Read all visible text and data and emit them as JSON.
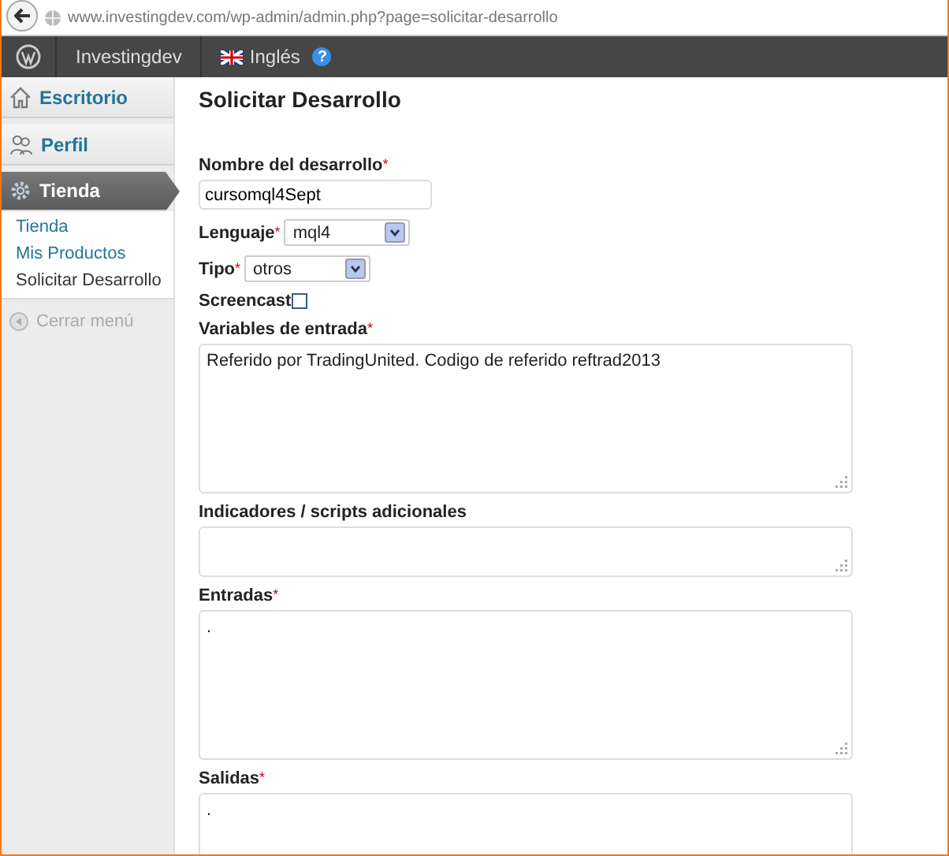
{
  "browser": {
    "url": "www.investingdev.com/wp-admin/admin.php?page=solicitar-desarrollo"
  },
  "admin_bar": {
    "site": "Investingdev",
    "language": "Inglés",
    "help": "?"
  },
  "sidebar": {
    "menus": [
      {
        "label": "Escritorio",
        "selected": false
      },
      {
        "label": "Perfil",
        "selected": false
      },
      {
        "label": "Tienda",
        "selected": true
      }
    ],
    "submenu": [
      {
        "label": "Tienda",
        "selected": false
      },
      {
        "label": "Mis Productos",
        "selected": false
      },
      {
        "label": "Solicitar Desarrollo",
        "selected": true
      }
    ],
    "collapse": "Cerrar menú"
  },
  "page": {
    "title": "Solicitar Desarrollo",
    "fields": [
      {
        "kind": "text",
        "label": "Nombre del desarrollo",
        "required_mark": "*",
        "value": "cursomql4Sept"
      },
      {
        "kind": "select",
        "label": "Lenguaje",
        "required_mark": "*",
        "value": "mql4"
      },
      {
        "kind": "select",
        "label": "Tipo",
        "required_mark": "*",
        "value": "otros"
      },
      {
        "kind": "checkbox",
        "label": "Screencast",
        "checked": false
      },
      {
        "kind": "textarea",
        "label": "Variables de entrada",
        "required_mark": "*",
        "value": "Referido por TradingUnited. Codigo de referido reftrad2013"
      },
      {
        "kind": "textarea",
        "label": "Indicadores / scripts adicionales"
      },
      {
        "kind": "textarea",
        "label": "Entradas",
        "required_mark": "*",
        "value": "."
      },
      {
        "kind": "textarea",
        "label": "Salidas",
        "required_mark": "*",
        "value": "."
      }
    ]
  }
}
